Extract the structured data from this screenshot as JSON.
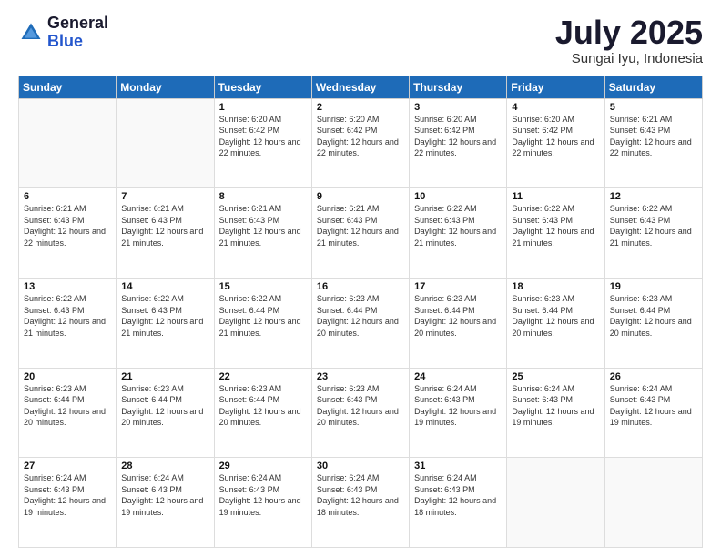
{
  "header": {
    "logo_general": "General",
    "logo_blue": "Blue",
    "month_year": "July 2025",
    "location": "Sungai Iyu, Indonesia"
  },
  "calendar": {
    "days_of_week": [
      "Sunday",
      "Monday",
      "Tuesday",
      "Wednesday",
      "Thursday",
      "Friday",
      "Saturday"
    ],
    "weeks": [
      [
        {
          "day": "",
          "info": ""
        },
        {
          "day": "",
          "info": ""
        },
        {
          "day": "1",
          "info": "Sunrise: 6:20 AM\nSunset: 6:42 PM\nDaylight: 12 hours and 22 minutes."
        },
        {
          "day": "2",
          "info": "Sunrise: 6:20 AM\nSunset: 6:42 PM\nDaylight: 12 hours and 22 minutes."
        },
        {
          "day": "3",
          "info": "Sunrise: 6:20 AM\nSunset: 6:42 PM\nDaylight: 12 hours and 22 minutes."
        },
        {
          "day": "4",
          "info": "Sunrise: 6:20 AM\nSunset: 6:42 PM\nDaylight: 12 hours and 22 minutes."
        },
        {
          "day": "5",
          "info": "Sunrise: 6:21 AM\nSunset: 6:43 PM\nDaylight: 12 hours and 22 minutes."
        }
      ],
      [
        {
          "day": "6",
          "info": "Sunrise: 6:21 AM\nSunset: 6:43 PM\nDaylight: 12 hours and 22 minutes."
        },
        {
          "day": "7",
          "info": "Sunrise: 6:21 AM\nSunset: 6:43 PM\nDaylight: 12 hours and 21 minutes."
        },
        {
          "day": "8",
          "info": "Sunrise: 6:21 AM\nSunset: 6:43 PM\nDaylight: 12 hours and 21 minutes."
        },
        {
          "day": "9",
          "info": "Sunrise: 6:21 AM\nSunset: 6:43 PM\nDaylight: 12 hours and 21 minutes."
        },
        {
          "day": "10",
          "info": "Sunrise: 6:22 AM\nSunset: 6:43 PM\nDaylight: 12 hours and 21 minutes."
        },
        {
          "day": "11",
          "info": "Sunrise: 6:22 AM\nSunset: 6:43 PM\nDaylight: 12 hours and 21 minutes."
        },
        {
          "day": "12",
          "info": "Sunrise: 6:22 AM\nSunset: 6:43 PM\nDaylight: 12 hours and 21 minutes."
        }
      ],
      [
        {
          "day": "13",
          "info": "Sunrise: 6:22 AM\nSunset: 6:43 PM\nDaylight: 12 hours and 21 minutes."
        },
        {
          "day": "14",
          "info": "Sunrise: 6:22 AM\nSunset: 6:43 PM\nDaylight: 12 hours and 21 minutes."
        },
        {
          "day": "15",
          "info": "Sunrise: 6:22 AM\nSunset: 6:44 PM\nDaylight: 12 hours and 21 minutes."
        },
        {
          "day": "16",
          "info": "Sunrise: 6:23 AM\nSunset: 6:44 PM\nDaylight: 12 hours and 20 minutes."
        },
        {
          "day": "17",
          "info": "Sunrise: 6:23 AM\nSunset: 6:44 PM\nDaylight: 12 hours and 20 minutes."
        },
        {
          "day": "18",
          "info": "Sunrise: 6:23 AM\nSunset: 6:44 PM\nDaylight: 12 hours and 20 minutes."
        },
        {
          "day": "19",
          "info": "Sunrise: 6:23 AM\nSunset: 6:44 PM\nDaylight: 12 hours and 20 minutes."
        }
      ],
      [
        {
          "day": "20",
          "info": "Sunrise: 6:23 AM\nSunset: 6:44 PM\nDaylight: 12 hours and 20 minutes."
        },
        {
          "day": "21",
          "info": "Sunrise: 6:23 AM\nSunset: 6:44 PM\nDaylight: 12 hours and 20 minutes."
        },
        {
          "day": "22",
          "info": "Sunrise: 6:23 AM\nSunset: 6:44 PM\nDaylight: 12 hours and 20 minutes."
        },
        {
          "day": "23",
          "info": "Sunrise: 6:23 AM\nSunset: 6:43 PM\nDaylight: 12 hours and 20 minutes."
        },
        {
          "day": "24",
          "info": "Sunrise: 6:24 AM\nSunset: 6:43 PM\nDaylight: 12 hours and 19 minutes."
        },
        {
          "day": "25",
          "info": "Sunrise: 6:24 AM\nSunset: 6:43 PM\nDaylight: 12 hours and 19 minutes."
        },
        {
          "day": "26",
          "info": "Sunrise: 6:24 AM\nSunset: 6:43 PM\nDaylight: 12 hours and 19 minutes."
        }
      ],
      [
        {
          "day": "27",
          "info": "Sunrise: 6:24 AM\nSunset: 6:43 PM\nDaylight: 12 hours and 19 minutes."
        },
        {
          "day": "28",
          "info": "Sunrise: 6:24 AM\nSunset: 6:43 PM\nDaylight: 12 hours and 19 minutes."
        },
        {
          "day": "29",
          "info": "Sunrise: 6:24 AM\nSunset: 6:43 PM\nDaylight: 12 hours and 19 minutes."
        },
        {
          "day": "30",
          "info": "Sunrise: 6:24 AM\nSunset: 6:43 PM\nDaylight: 12 hours and 18 minutes."
        },
        {
          "day": "31",
          "info": "Sunrise: 6:24 AM\nSunset: 6:43 PM\nDaylight: 12 hours and 18 minutes."
        },
        {
          "day": "",
          "info": ""
        },
        {
          "day": "",
          "info": ""
        }
      ]
    ]
  }
}
